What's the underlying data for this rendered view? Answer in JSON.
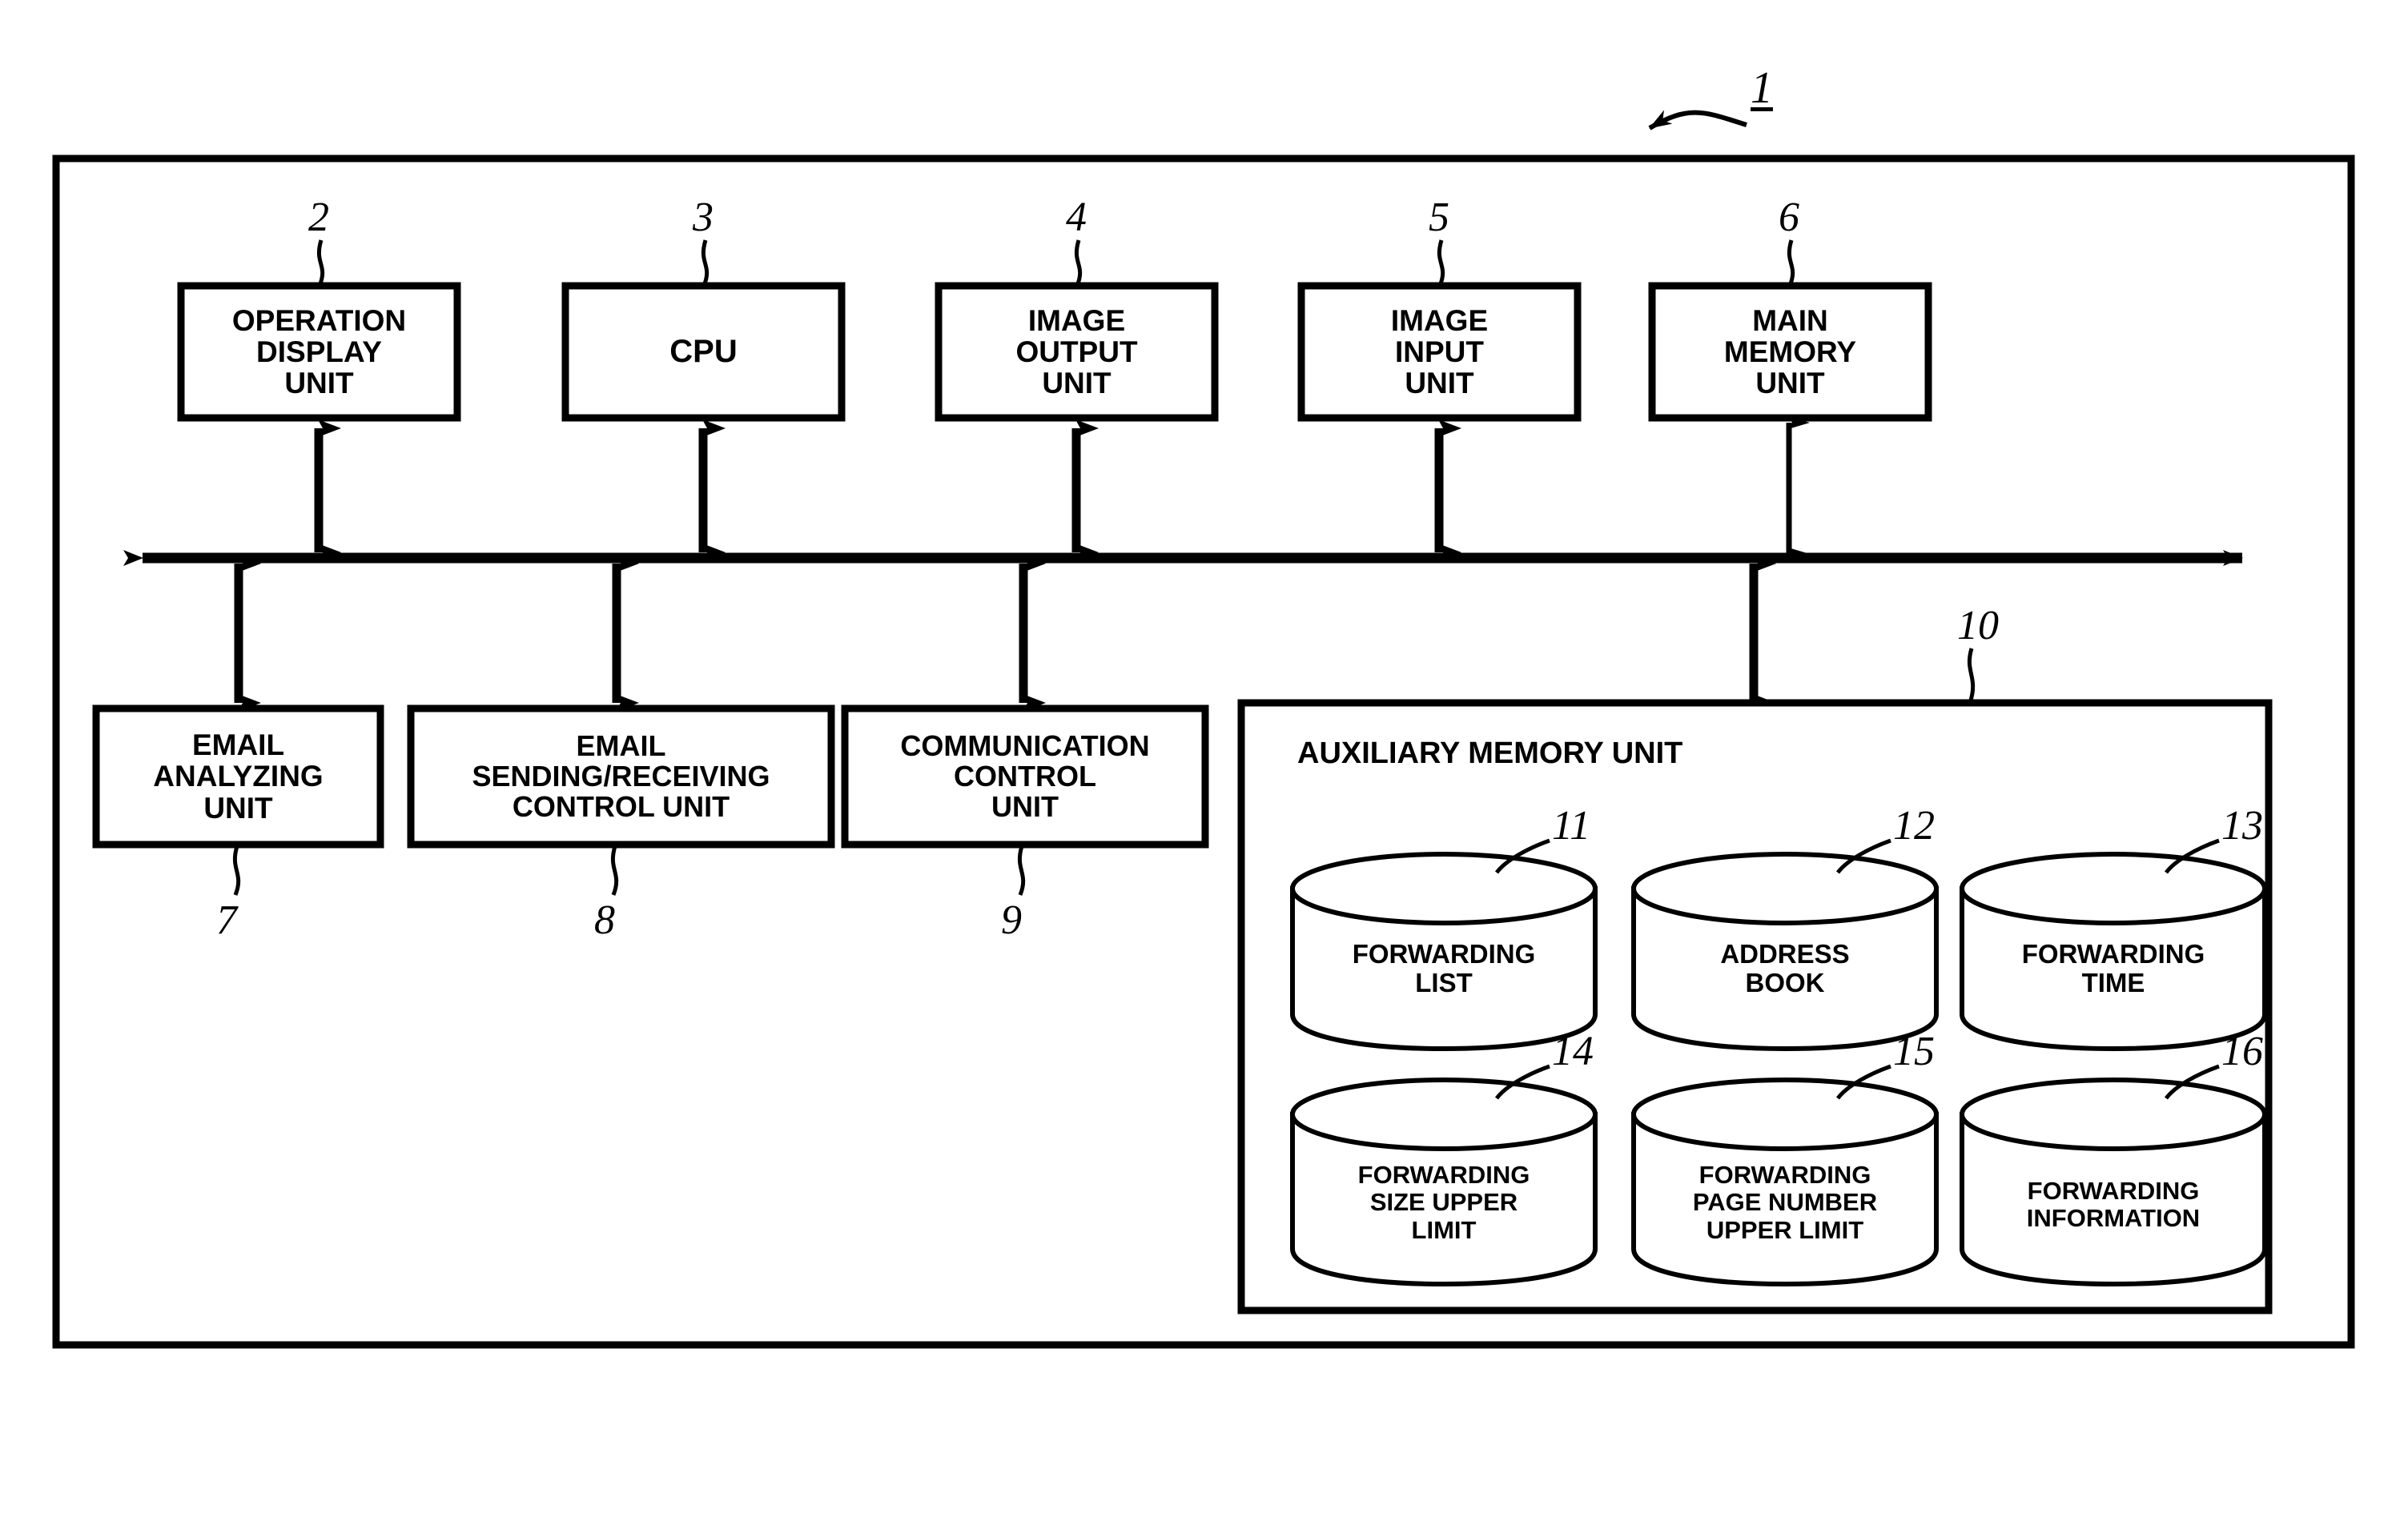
{
  "figure": {
    "type": "patent-block-diagram",
    "system_numeral": "1",
    "background_color": "#ffffff",
    "line_color": "#000000"
  },
  "outer_frame": {
    "name": "image-forming-apparatus-frame",
    "numeral": "1"
  },
  "bus": {
    "name": "system-bus",
    "double_ended": true
  },
  "top_units": [
    {
      "numeral": "2",
      "lines": [
        "OPERATION",
        "DISPLAY",
        "UNIT"
      ]
    },
    {
      "numeral": "3",
      "lines": [
        "CPU"
      ]
    },
    {
      "numeral": "4",
      "lines": [
        "IMAGE",
        "OUTPUT",
        "UNIT"
      ]
    },
    {
      "numeral": "5",
      "lines": [
        "IMAGE",
        "INPUT",
        "UNIT"
      ]
    },
    {
      "numeral": "6",
      "lines": [
        "MAIN",
        "MEMORY",
        "UNIT"
      ]
    }
  ],
  "bottom_units": [
    {
      "numeral": "7",
      "lines": [
        "EMAIL",
        "ANALYZING",
        "UNIT"
      ]
    },
    {
      "numeral": "8",
      "lines": [
        "EMAIL",
        "SENDING/RECEIVING",
        "CONTROL UNIT"
      ]
    },
    {
      "numeral": "9",
      "lines": [
        "COMMUNICATION",
        "CONTROL",
        "UNIT"
      ]
    }
  ],
  "auxiliary_memory_unit": {
    "numeral": "10",
    "title": "AUXILIARY MEMORY UNIT",
    "stores": [
      {
        "numeral": "11",
        "lines": [
          "FORWARDING",
          "LIST"
        ]
      },
      {
        "numeral": "12",
        "lines": [
          "ADDRESS",
          "BOOK"
        ]
      },
      {
        "numeral": "13",
        "lines": [
          "FORWARDING",
          "TIME"
        ]
      },
      {
        "numeral": "14",
        "lines": [
          "FORWARDING",
          "SIZE UPPER",
          "LIMIT"
        ]
      },
      {
        "numeral": "15",
        "lines": [
          "FORWARDING",
          "PAGE NUMBER",
          "UPPER LIMIT"
        ]
      },
      {
        "numeral": "16",
        "lines": [
          "FORWARDING",
          "INFORMATION"
        ]
      }
    ]
  }
}
